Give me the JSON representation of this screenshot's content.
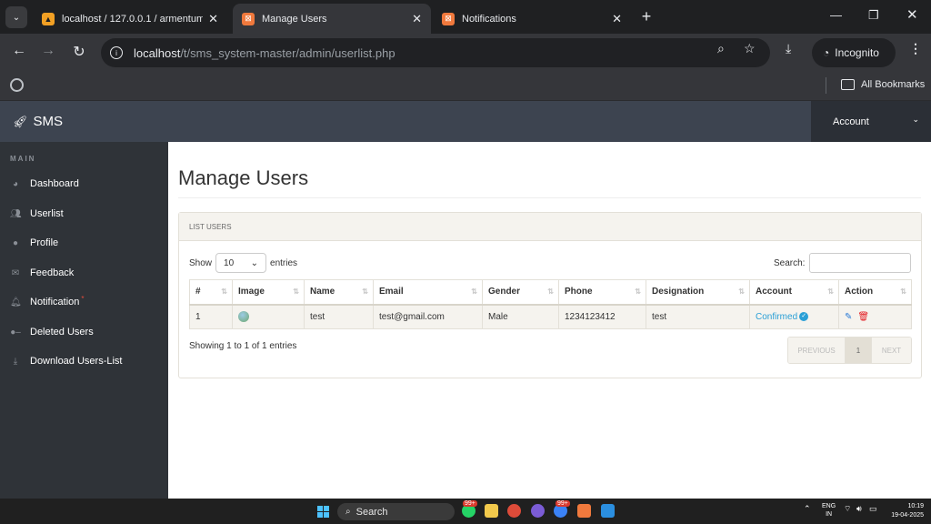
{
  "browser": {
    "tabs": [
      {
        "title": "localhost / 127.0.0.1 / armentum /",
        "active": false
      },
      {
        "title": "Manage Users",
        "active": true
      },
      {
        "title": "Notifications",
        "active": false
      }
    ],
    "url_host": "localhost",
    "url_path": "/t/sms_system-master/admin/userlist.php",
    "incognito_label": "Incognito",
    "all_bookmarks_label": "All Bookmarks"
  },
  "app": {
    "brand": "SMS",
    "account_label": "Account"
  },
  "sidebar": {
    "section_label": "MAIN",
    "items": [
      {
        "label": "Dashboard",
        "icon": "dashboard-icon"
      },
      {
        "label": "Userlist",
        "icon": "users-icon"
      },
      {
        "label": "Profile",
        "icon": "user-icon"
      },
      {
        "label": "Feedback",
        "icon": "envelope-icon"
      },
      {
        "label": "Notification",
        "icon": "bell-icon",
        "badge": "*"
      },
      {
        "label": "Deleted Users",
        "icon": "user-minus-icon"
      },
      {
        "label": "Download Users-List",
        "icon": "download-icon"
      }
    ]
  },
  "main": {
    "title": "Manage Users",
    "panel_heading": "LIST USERS",
    "show_label": "Show",
    "entries_value": "10",
    "entries_label": "entries",
    "search_label": "Search:",
    "columns": [
      "#",
      "Image",
      "Name",
      "Email",
      "Gender",
      "Phone",
      "Designation",
      "Account",
      "Action"
    ],
    "rows": [
      {
        "num": "1",
        "name": "test",
        "email": "test@gmail.com",
        "gender": "Male",
        "phone": "1234123412",
        "designation": "test",
        "account": "Confirmed"
      }
    ],
    "showing_text": "Showing 1 to 1 of 1 entries",
    "pager": {
      "previous": "PREVIOUS",
      "page": "1",
      "next": "NEXT"
    }
  },
  "taskbar": {
    "search_label": "Search",
    "badge_1": "99+",
    "badge_2": "99+",
    "lang_1": "ENG",
    "lang_2": "IN",
    "time": "10:19",
    "date": "19-04-2025"
  },
  "colors": {
    "header_bg": "#3d4450",
    "sidebar_bg": "#2f3338",
    "confirmed": "#2a9fd6",
    "delete": "#e31e24"
  }
}
